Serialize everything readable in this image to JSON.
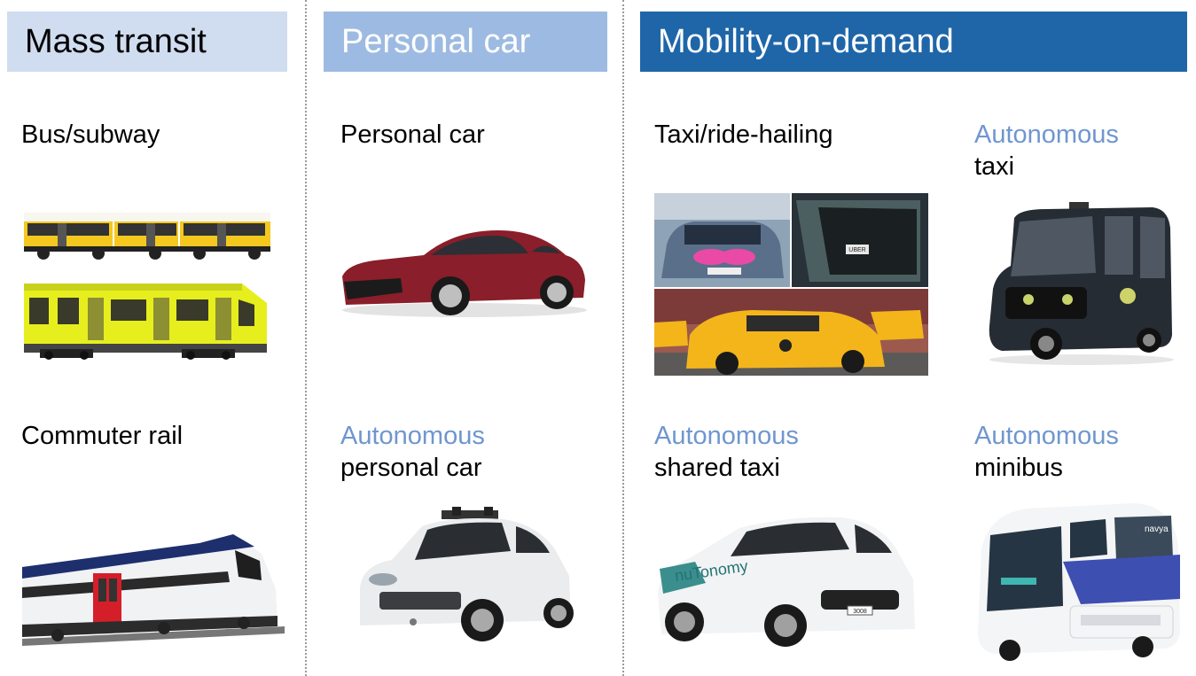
{
  "headers": {
    "mass_transit": "Mass transit",
    "personal_car": "Personal car",
    "mobility": "Mobility-on-demand"
  },
  "labels": {
    "bus_subway": "Bus/subway",
    "commuter_rail": "Commuter rail",
    "personal_car": "Personal car",
    "auto_personal_word": "Autonomous",
    "auto_personal_rest": "personal car",
    "taxi": "Taxi/ride-hailing",
    "auto_taxi_word": "Autonomous",
    "auto_taxi_rest": "taxi",
    "auto_shared_word": "Autonomous",
    "auto_shared_rest": "shared taxi",
    "auto_minibus_word": "Autonomous",
    "auto_minibus_rest": "minibus"
  },
  "photo_texts": {
    "uber": "UBER",
    "nutonomy": "nuTonomy",
    "plate": "3008",
    "navya": "navya"
  },
  "colors": {
    "header_mass": "#d0dcef",
    "header_personal": "#9dbbe2",
    "header_mobility": "#1f66a8",
    "autonomous_text": "#6f96cf"
  }
}
